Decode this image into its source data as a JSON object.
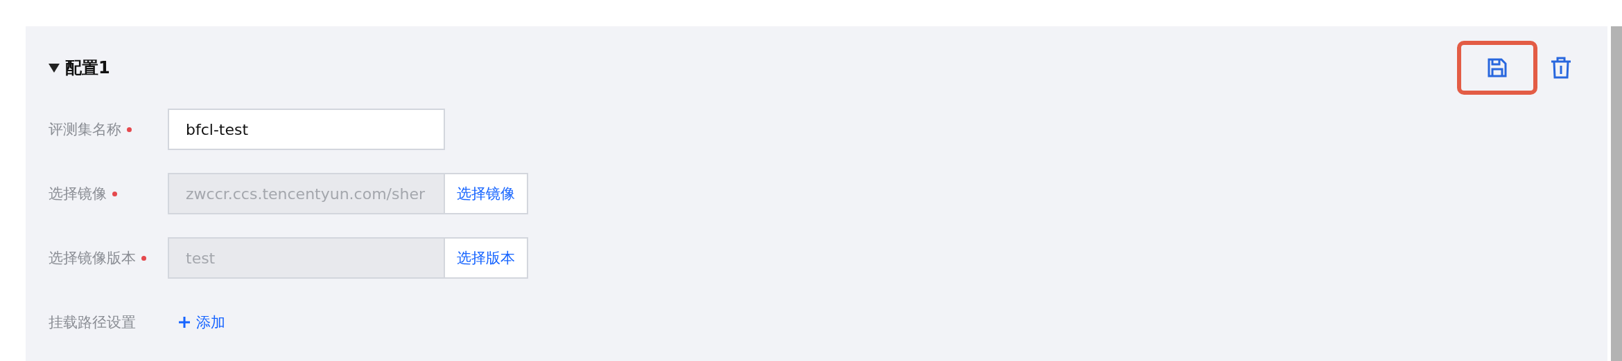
{
  "section": {
    "title": "配置1",
    "expanded": true
  },
  "actions": [
    {
      "kind": "save",
      "highlighted": true
    },
    {
      "kind": "delete",
      "highlighted": false
    }
  ],
  "fields": [
    {
      "label": "评测集名称",
      "required": true,
      "kind": "text",
      "value": "bfcl-test",
      "disabled": false
    },
    {
      "label": "选择镜像",
      "required": true,
      "kind": "picker",
      "value": "zwccr.ccs.tencentyun.com/sher",
      "disabled": true,
      "button": "选择镜像"
    },
    {
      "label": "选择镜像版本",
      "required": true,
      "kind": "picker",
      "value": "test",
      "disabled": true,
      "button": "选择版本"
    },
    {
      "label": "挂载路径设置",
      "required": false,
      "kind": "add",
      "link": "添加"
    }
  ]
}
